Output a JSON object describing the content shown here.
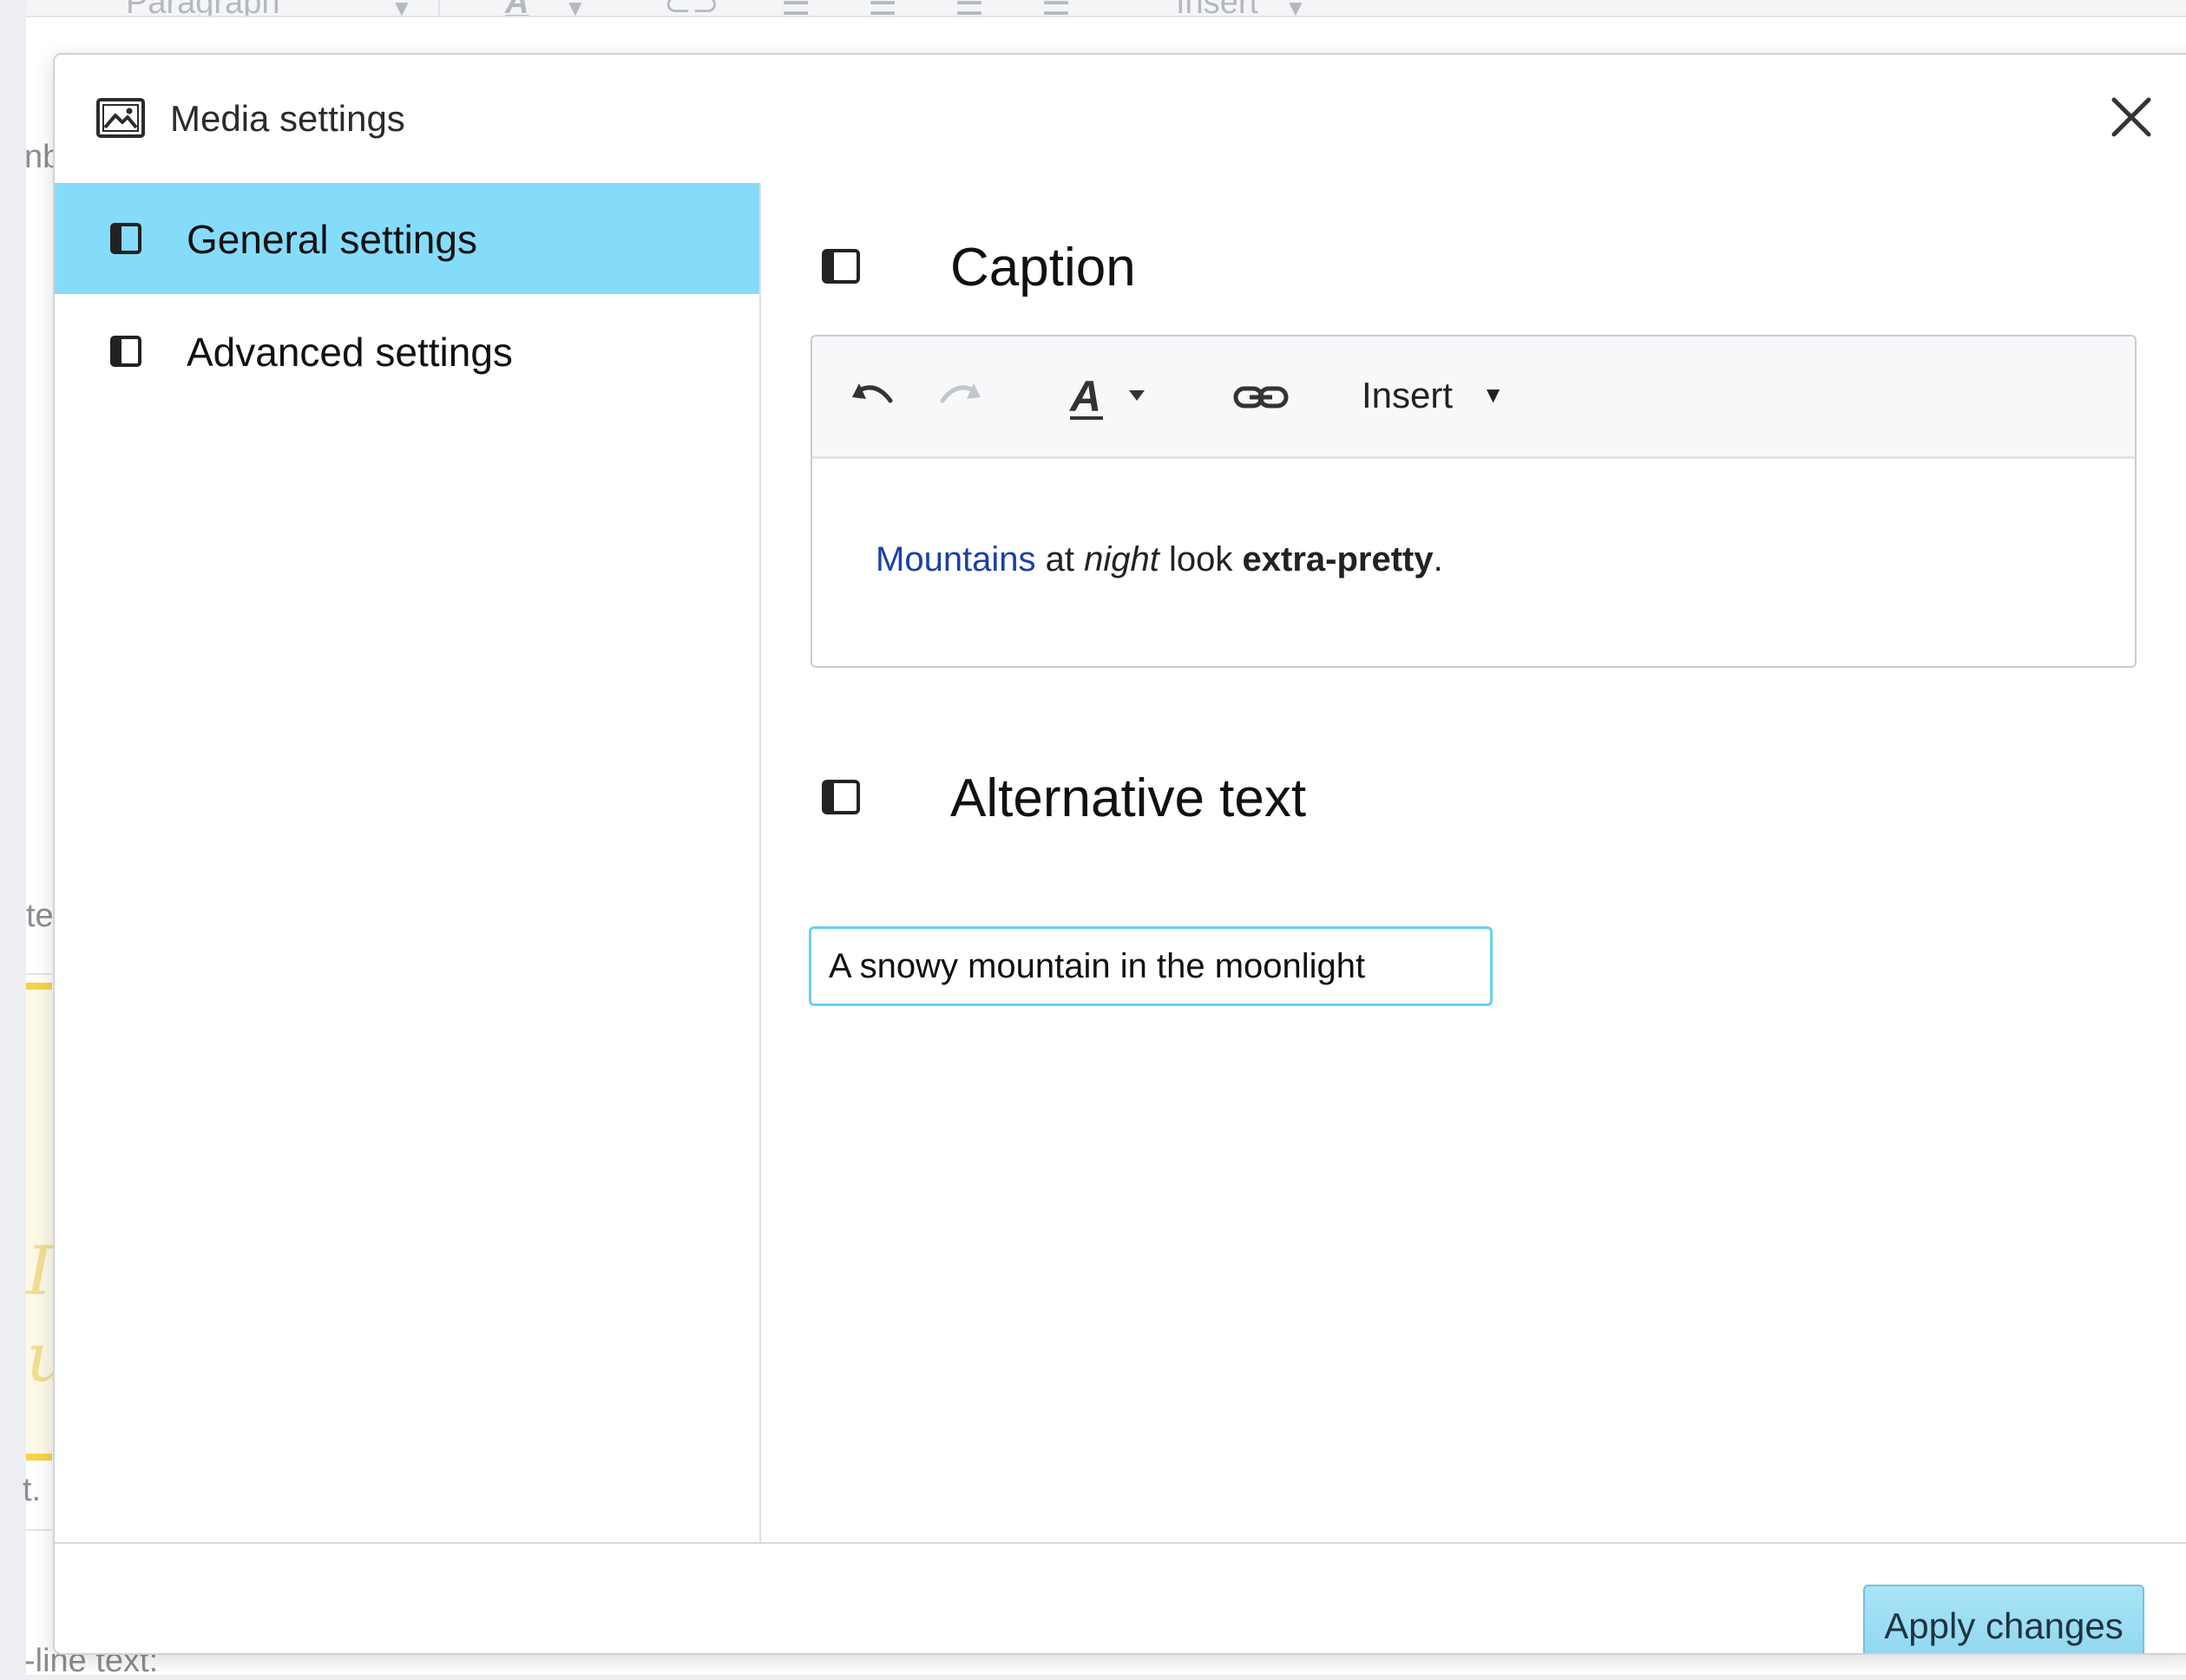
{
  "background": {
    "toolbar": {
      "paragraph_label": "Paragraph",
      "insert_label": "Insert"
    },
    "fragments": {
      "left_top": "nb",
      "left_mid": "te",
      "left_low": "t.",
      "bottom": "-line text:"
    },
    "accent_yellow": "#f4d44b"
  },
  "modal": {
    "title": "Media settings",
    "close_label": "close",
    "sidebar": {
      "items": [
        {
          "label": "General settings",
          "active": true
        },
        {
          "label": "Advanced settings",
          "active": false
        }
      ]
    },
    "caption": {
      "title": "Caption",
      "toolbar": {
        "undo": "undo-icon",
        "redo": "redo-icon",
        "text_style": "text-style-icon",
        "link": "link-icon",
        "insert_label": "Insert"
      },
      "content": {
        "link_text": "Mountains",
        "part1": " at ",
        "italic_text": "night",
        "part2": " look ",
        "bold_text": "extra-pretty",
        "end": "."
      }
    },
    "alt_text": {
      "title": "Alternative text",
      "value": "A snowy mountain in the moonlight"
    },
    "footer": {
      "apply_label": "Apply changes"
    }
  },
  "colors": {
    "active_sidebar": "#85dcfa",
    "focus_border": "#68cff5",
    "link": "#1a3fa8",
    "apply_button": "#a8e4f7"
  }
}
